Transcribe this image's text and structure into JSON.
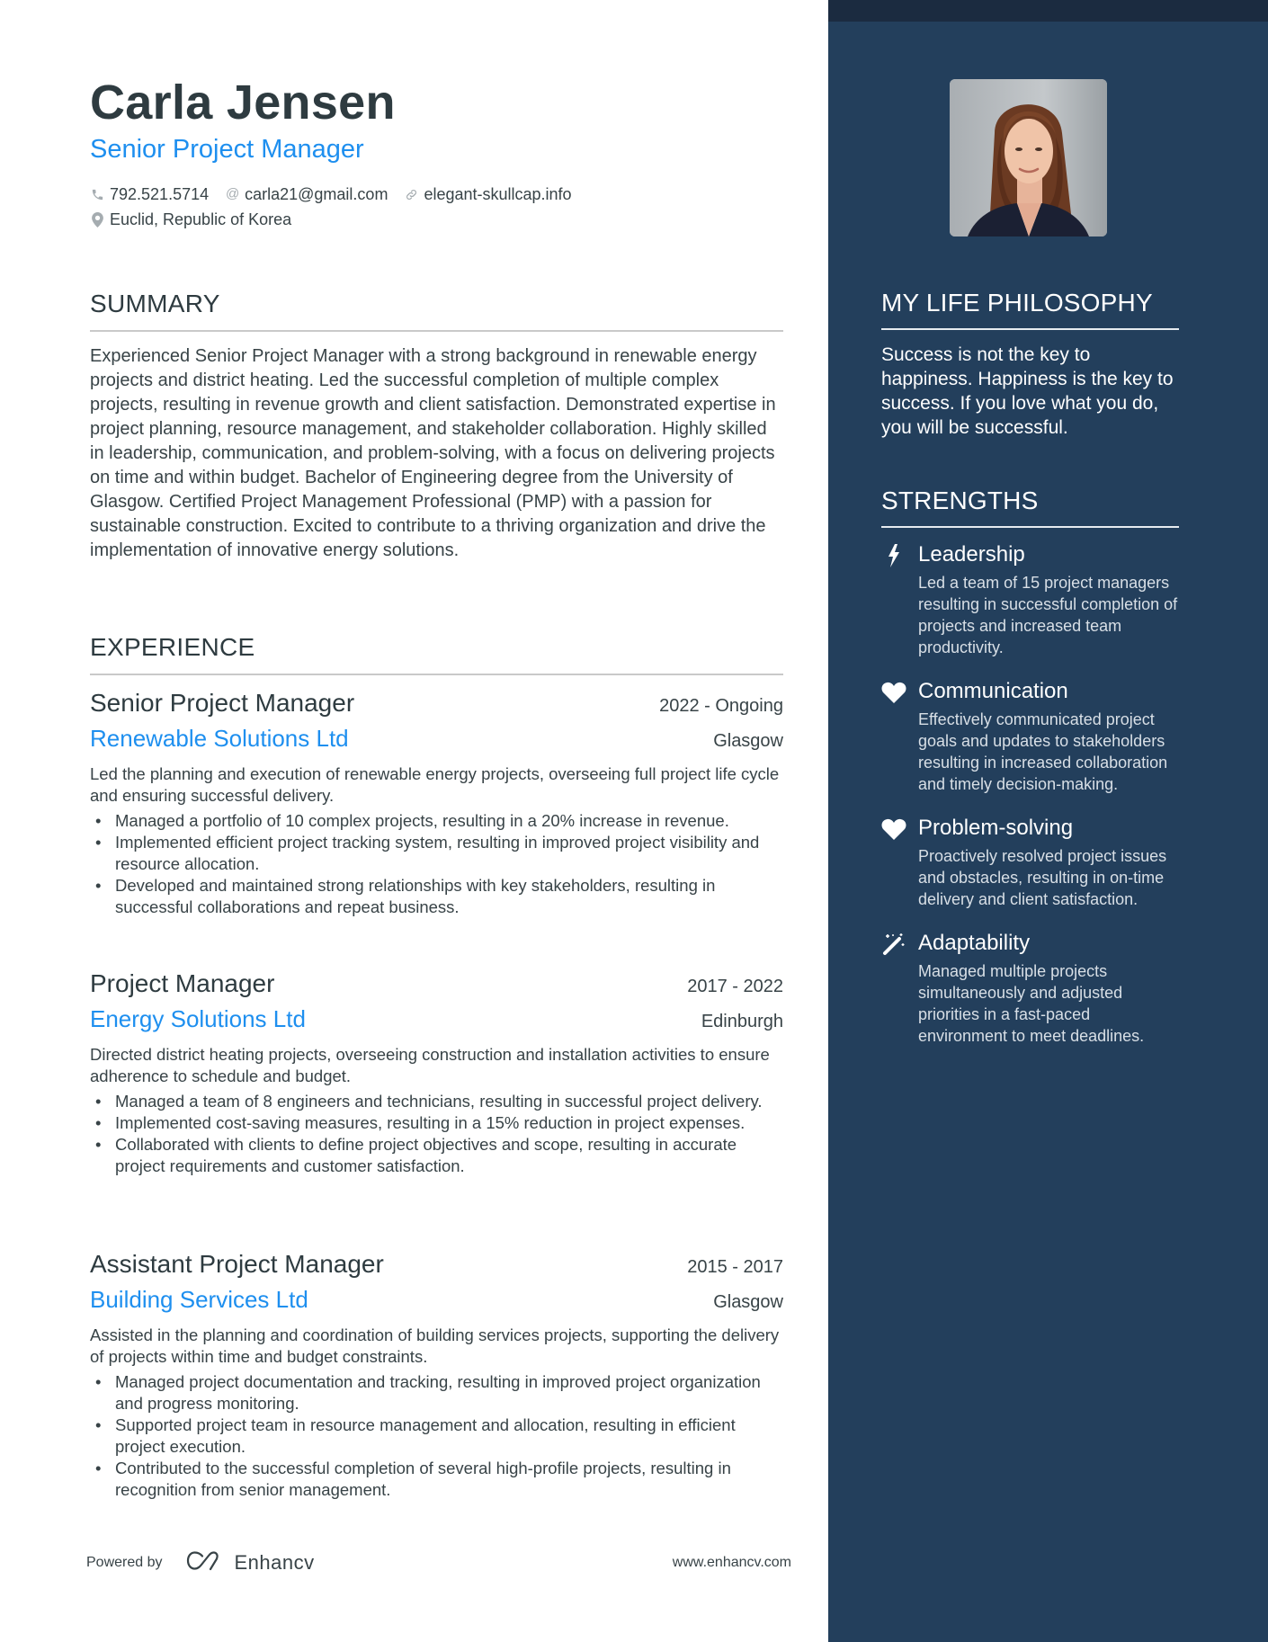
{
  "header": {
    "name": "Carla Jensen",
    "title": "Senior Project Manager",
    "contacts": {
      "phone": {
        "icon": "phone-icon",
        "value": "792.521.5714"
      },
      "email": {
        "icon": "at-icon",
        "value": "carla21@gmail.com"
      },
      "website": {
        "icon": "link-icon",
        "value": "elegant-skullcap.info"
      },
      "location": {
        "icon": "map-pin-icon",
        "value": "Euclid, Republic of Korea"
      }
    }
  },
  "summary": {
    "heading": "SUMMARY",
    "text": "Experienced Senior Project Manager with a strong background in renewable energy projects and district heating. Led the successful completion of multiple complex projects, resulting in revenue growth and client satisfaction. Demonstrated expertise in project planning, resource management, and stakeholder collaboration. Highly skilled in leadership, communication, and problem-solving, with a focus on delivering projects on time and within budget. Bachelor of Engineering degree from the University of Glasgow. Certified Project Management Professional (PMP) with a passion for sustainable construction. Excited to contribute to a thriving organization and drive the implementation of innovative energy solutions."
  },
  "experience": {
    "heading": "EXPERIENCE",
    "jobs": [
      {
        "title": "Senior Project Manager",
        "dates": "2022 - Ongoing",
        "company": "Renewable Solutions Ltd",
        "location": "Glasgow",
        "description": "Led the planning and execution of renewable energy projects, overseeing full project life cycle and ensuring successful delivery.",
        "bullets": [
          "Managed a portfolio of 10 complex projects, resulting in a 20% increase in revenue.",
          "Implemented efficient project tracking system, resulting in improved project visibility and resource allocation.",
          "Developed and maintained strong relationships with key stakeholders, resulting in successful collaborations and repeat business."
        ]
      },
      {
        "title": "Project Manager",
        "dates": "2017 - 2022",
        "company": "Energy Solutions Ltd",
        "location": "Edinburgh",
        "description": "Directed district heating projects, overseeing construction and installation activities to ensure adherence to schedule and budget.",
        "bullets": [
          "Managed a team of 8 engineers and technicians, resulting in successful project delivery.",
          "Implemented cost-saving measures, resulting in a 15% reduction in project expenses.",
          "Collaborated with clients to define project objectives and scope, resulting in accurate project requirements and customer satisfaction."
        ]
      },
      {
        "title": "Assistant Project Manager",
        "dates": "2015 - 2017",
        "company": "Building Services Ltd",
        "location": "Glasgow",
        "description": "Assisted in the planning and coordination of building services projects, supporting the delivery of projects within time and budget constraints.",
        "bullets": [
          "Managed project documentation and tracking, resulting in improved project organization and progress monitoring.",
          "Supported project team in resource management and allocation, resulting in efficient project execution.",
          "Contributed to the successful completion of several high-profile projects, resulting in recognition from senior management."
        ]
      }
    ]
  },
  "sidebar": {
    "photo_alt": "Profile photo of Carla Jensen",
    "philosophy": {
      "heading": "MY LIFE PHILOSOPHY",
      "text": "Success is not the key to happiness. Happiness is the key to success. If you love what you do, you will be successful."
    },
    "strengths": {
      "heading": "STRENGTHS",
      "items": [
        {
          "icon": "lightning-icon",
          "title": "Leadership",
          "description": "Led a team of 15 project managers resulting in successful completion of projects and increased team productivity."
        },
        {
          "icon": "heart-icon",
          "title": "Communication",
          "description": "Effectively communicated project goals and updates to stakeholders resulting in increased collaboration and timely decision-making."
        },
        {
          "icon": "heart-icon",
          "title": "Problem-solving",
          "description": "Proactively resolved project issues and obstacles, resulting in on-time delivery and client satisfaction."
        },
        {
          "icon": "magic-wand-icon",
          "title": "Adaptability",
          "description": "Managed multiple projects simultaneously and adjusted priorities in a fast-paced environment to meet deadlines."
        }
      ]
    }
  },
  "footer": {
    "powered_by": "Powered by",
    "brand": "Enhancv",
    "url": "www.enhancv.com"
  },
  "colors": {
    "accent": "#1E8FEF",
    "sidebar_bg": "#233F5C",
    "sidebar_band": "#1B2B40",
    "text": "#384347"
  }
}
